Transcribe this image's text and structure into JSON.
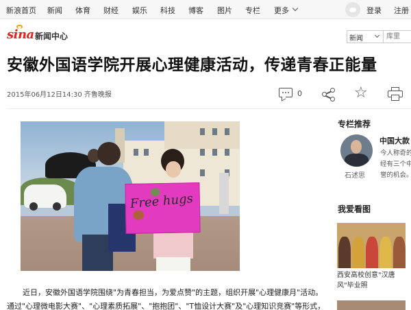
{
  "topnav": {
    "items": [
      "新浪首页",
      "新闻",
      "体育",
      "财经",
      "娱乐",
      "科技",
      "博客",
      "图片",
      "专栏",
      "更多"
    ],
    "login": "登录",
    "register": "注册"
  },
  "header": {
    "logo_text": "sina",
    "section_label": "新闻中心",
    "search_scope": "新闻",
    "search_placeholder": "库里"
  },
  "article": {
    "title": "安徽外国语学院开展心理健康活动，传递青春正能量",
    "date": "2015年06月12日14:30",
    "source": "齐鲁晚报",
    "comment_count": "0",
    "photo_sign_text": "Free hugs",
    "paragraphs": [
      "近日，安徽外国语学院围绕\"为青春担当，为爱点赞\"的主题，组织开展\"心理健康月\"活动。",
      "通过\"心理微电影大赛\"、\"心理素质拓展\"、\"抱抱团\"、\"T恤设计大赛\"及\"心理知识竞赛\"等形式，"
    ]
  },
  "sidebar": {
    "column_title": "专栏推荐",
    "column_name": "中国大款",
    "column_lines": [
      "今人称奇的",
      "经有三个中",
      "誉的机会。"
    ],
    "author": "石述思",
    "photos_title": "我爱看图",
    "photo_caption_lines": [
      "西安高校创意\"汉唐",
      "风\"毕业照"
    ]
  },
  "colors": {
    "brand_red": "#e2231a",
    "sign_pink": "#e23bbf"
  },
  "icons": [
    "chevron-down-icon",
    "weibo-icon",
    "comment-icon",
    "share-icon",
    "star-icon",
    "print-icon"
  ]
}
